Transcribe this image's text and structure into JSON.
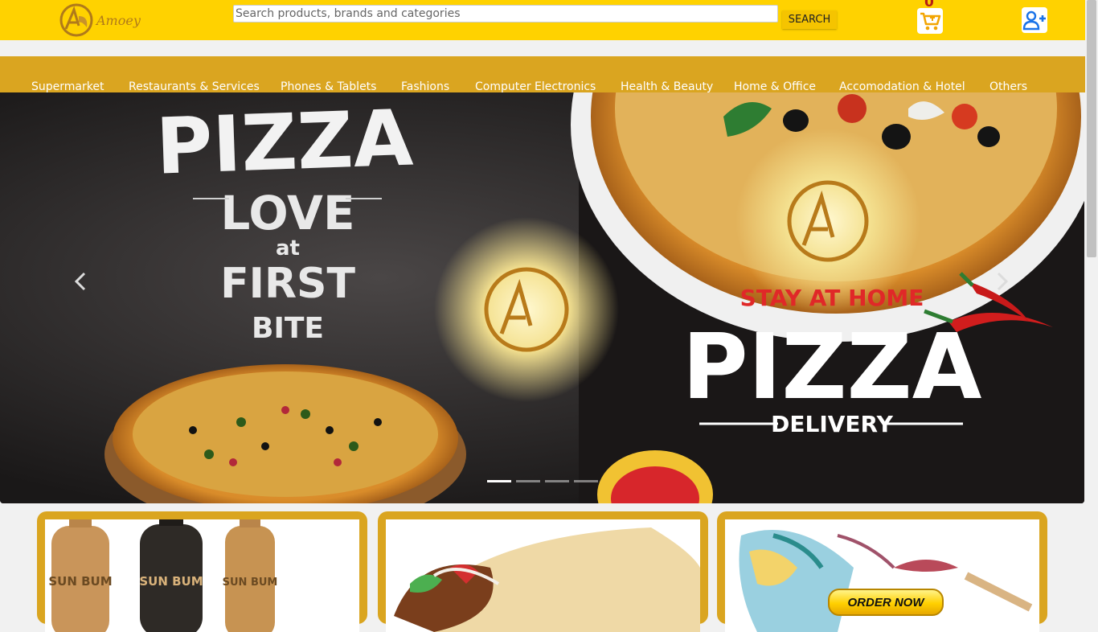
{
  "header": {
    "logo_text": "Amoey",
    "search_placeholder": "Search products, brands and categories",
    "search_button": "SEARCH",
    "cart_count": "0",
    "colors": {
      "bar": "#ffd200",
      "nav": "#daa520"
    }
  },
  "nav": {
    "items": [
      {
        "label": "Supermarket"
      },
      {
        "label": "Restaurants & Services"
      },
      {
        "label": "Phones & Tablets"
      },
      {
        "label": "Fashions"
      },
      {
        "label": "Computer Electronics"
      },
      {
        "label": "Health & Beauty"
      },
      {
        "label": "Home & Office"
      },
      {
        "label": "Accomodation & Hotel"
      },
      {
        "label": "Others"
      }
    ]
  },
  "hero": {
    "left_pizza": "PIZZA",
    "left_love": "LOVE",
    "left_at": "at",
    "left_first": "FIRST",
    "left_bite": "BITE",
    "right_stay": "STAY AT HOME",
    "right_pizza": "PIZZA",
    "right_delivery": "DELIVERY",
    "slides": 4,
    "active_slide": 1,
    "icons": [
      "chevron-left-icon",
      "chevron-right-icon"
    ]
  },
  "cards": [
    {
      "name": "sun-bum-products",
      "brand_text": "SUN BUM"
    },
    {
      "name": "shawarma-wrap"
    },
    {
      "name": "fashion-shoes",
      "cta": "ORDER NOW"
    }
  ]
}
